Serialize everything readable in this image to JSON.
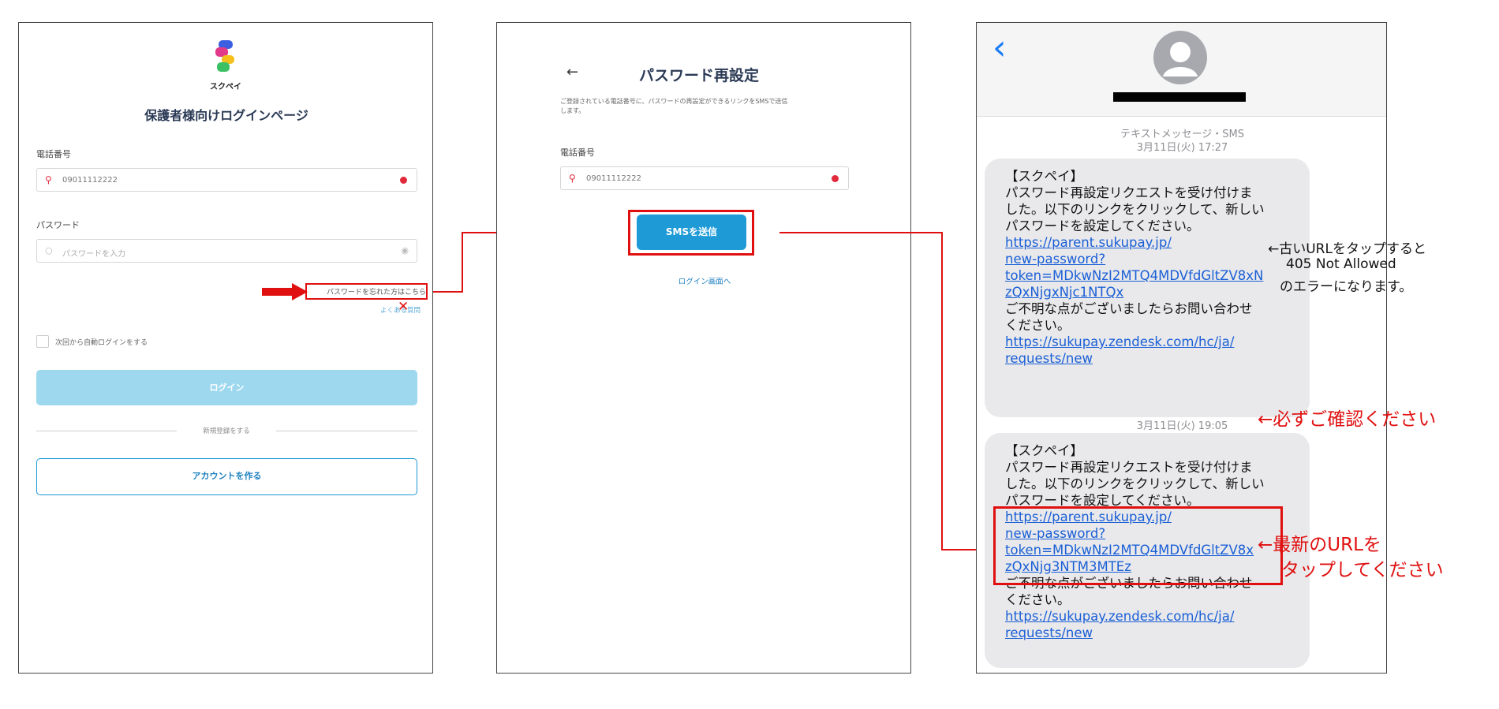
{
  "login": {
    "logo_text": "スクペイ",
    "title": "保護者様向けログインページ",
    "phone_label": "電話番号",
    "phone_value": "09011112222",
    "password_label": "パスワード",
    "password_placeholder": "パスワードを入力",
    "forgot_link": "パスワードを忘れた方はこちら",
    "faq_link": "よくある質問",
    "remember_label": "次回から自動ログインをする",
    "login_button": "ログイン",
    "divider_text": "新規登録をする",
    "create_account_button": "アカウントを作る"
  },
  "reset": {
    "back_arrow": "←",
    "title": "パスワード再設定",
    "description_line1": "ご登録されている電話番号に、パスワードの再設定ができるリンクをSMSで送信",
    "description_line2": "します。",
    "phone_label": "電話番号",
    "phone_value": "09011112222",
    "send_button": "SMSを送信",
    "back_link": "ログイン画面へ"
  },
  "sms": {
    "back_chevron": "‹",
    "header_meta": "テキストメッセージ・SMS",
    "header_date": "3月11日(火) 17:27",
    "message1": {
      "line1": "【スクペイ】",
      "line2": " パスワード再設定リクエストを受け付けま",
      "line3": "した。以下のリンクをクリックして、新しい",
      "line4": "パスワードを設定してください。",
      "link1a": " https://parent.sukupay.jp/",
      "link1b": "new-password?",
      "link1c": "token=MDkwNzI2MTQ4MDVfdGltZV8xN",
      "link1d": "zQxNjgxNjc1NTQx",
      "line5": " ご不明な点がございましたらお問い合わせ",
      "line6": "ください。",
      "link2a": " https://sukupay.zendesk.com/hc/ja/",
      "link2b": "requests/new"
    },
    "date2": "3月11日(火) 19:05",
    "message2": {
      "line1": "【スクペイ】",
      "line2": " パスワード再設定リクエストを受け付けま",
      "line3": "した。以下のリンクをクリックして、新しい",
      "line4": "パスワードを設定してください。",
      "link1a": " https://parent.sukupay.jp/",
      "link1b": "new-password?",
      "link1c": "token=MDkwNzI2MTQ4MDVfdGltZV8x",
      "link1d": "zQxNjg3NTM3MTEz",
      "line5": " ご不明な点がございましたらお問い合わせ",
      "line6": "ください。",
      "link2a": " https://sukupay.zendesk.com/hc/ja/",
      "link2b": "requests/new"
    }
  },
  "annotations": {
    "old_url_line1": "←古いURLをタップすると",
    "old_url_line2": "405 Not Allowed",
    "old_url_line3": "のエラーになります。",
    "confirm": "←必ずご確認ください",
    "latest_line1": "←最新のURLを",
    "latest_line2": "タップしてください"
  },
  "colors": {
    "accent_blue": "#1e9ad6",
    "disabled_blue": "#9dd8ef",
    "annotation_red": "#e01010",
    "link_blue": "#1a5fd6"
  }
}
